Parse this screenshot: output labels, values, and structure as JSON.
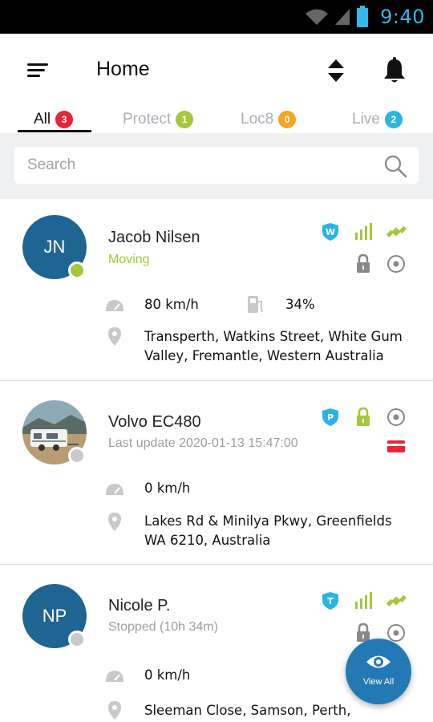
{
  "status_bar": {
    "time": "9:40"
  },
  "header": {
    "title": "Home"
  },
  "tabs": [
    {
      "label": "All",
      "count": "3",
      "color": "#e8243a"
    },
    {
      "label": "Protect",
      "count": "1",
      "color": "#a5c73a"
    },
    {
      "label": "Loc8",
      "count": "0",
      "color": "#f5a623"
    },
    {
      "label": "Live",
      "count": "2",
      "color": "#2bb4e3"
    }
  ],
  "search": {
    "placeholder": "Search"
  },
  "devices": [
    {
      "initials": "JN",
      "name": "Jacob Nilsen",
      "status": "Moving",
      "speed": "80 km/h",
      "fuel": "34%",
      "address": "Transperth, Watkins Street, White Gum Valley, Fremantle, Western Australia",
      "type_badge": "W"
    },
    {
      "initials": "",
      "name": "Volvo EC480",
      "status": "Last update 2020-01-13 15:47:00",
      "speed": "0 km/h",
      "address": "Lakes Rd & Minilya Pkwy, Greenfields WA 6210, Australia",
      "type_badge": "P"
    },
    {
      "initials": "NP",
      "name": "Nicole P.",
      "status": "Stopped (10h 34m)",
      "speed": "0 km/h",
      "address": "Sleeman Close, Samson, Perth,",
      "type_badge": "T"
    }
  ],
  "fab": {
    "label": "View All"
  },
  "colors": {
    "accent_blue": "#1f6593",
    "badge_cyan": "#2bb4e3",
    "moving_green": "#a5c73a",
    "alert_red": "#e8243a"
  }
}
